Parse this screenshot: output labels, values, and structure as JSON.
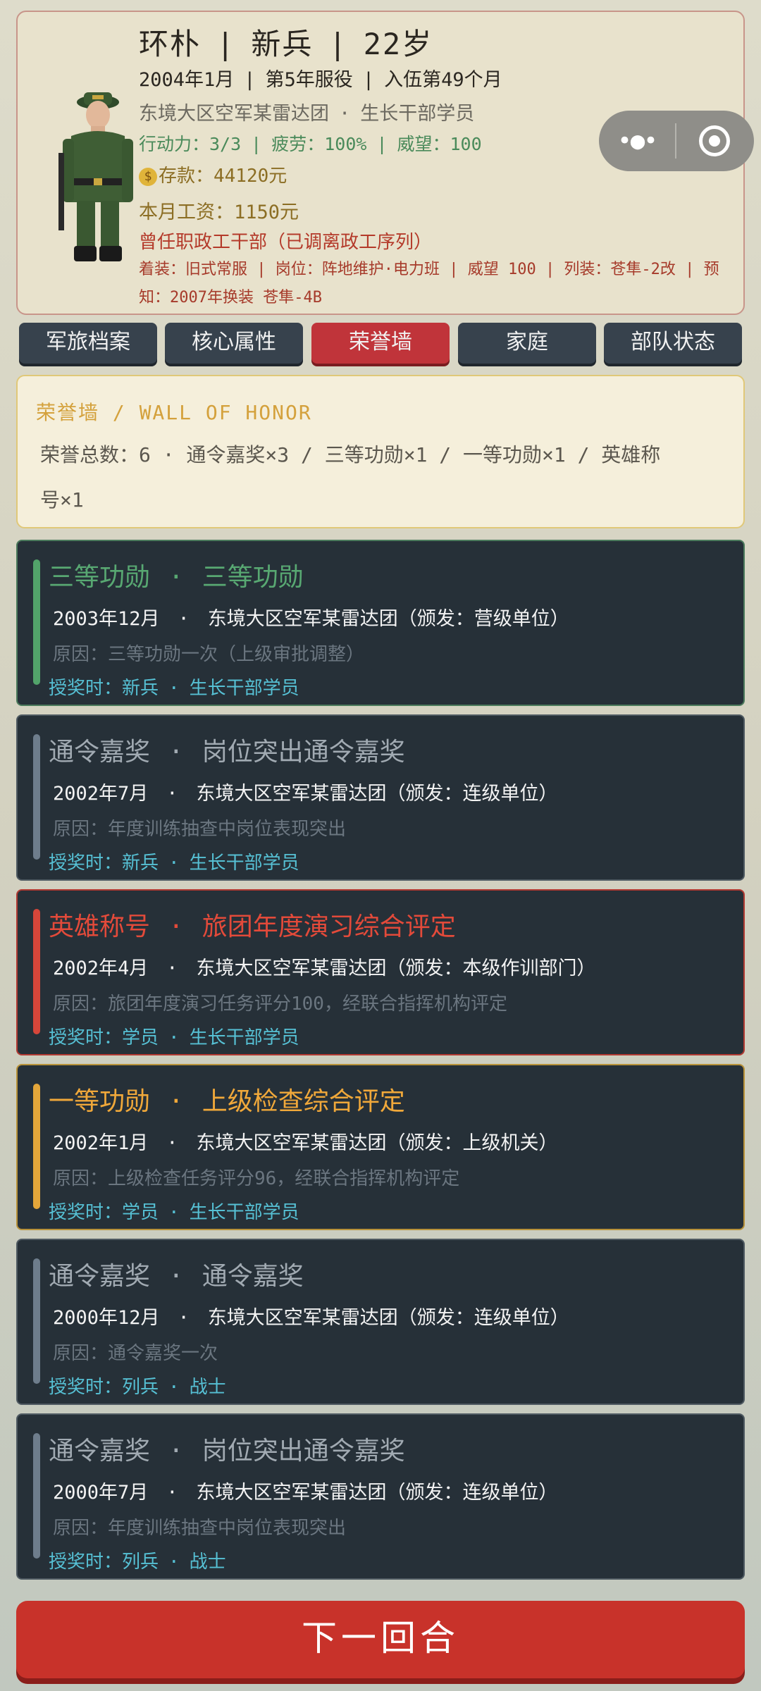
{
  "profile": {
    "name": "环朴",
    "rank": "新兵",
    "age": "22岁",
    "date": "2004年1月",
    "service_year": "第5年服役",
    "enlist": "入伍第49个月",
    "unit": "东境大区空军某雷达团",
    "role": "生长干部学员",
    "action": "行动力：3/3",
    "fatigue": "疲劳：100%",
    "prestige": "威望：100",
    "savings": "存款：44120元",
    "salary": "本月工资：1150元",
    "former": "曾任职政工干部（已调离政工序列）",
    "equipment": "着装：旧式常服 | 岗位：阵地维护·电力班 | 威望 100 | 列装：苍隼-2改 | 预知：2007年换装 苍隼-4B",
    "avatar_icon": "soldier-avatar-icon",
    "coin_icon": "money-bag-icon"
  },
  "capsule": {
    "more_icon": "more-dots-icon",
    "close_icon": "target-circle-icon"
  },
  "tabs": [
    {
      "label": "军旅档案",
      "active": false
    },
    {
      "label": "核心属性",
      "active": false
    },
    {
      "label": "荣誉墙",
      "active": true
    },
    {
      "label": "家庭",
      "active": false
    },
    {
      "label": "部队状态",
      "active": false
    }
  ],
  "summary": {
    "title": "荣誉墙 / WALL OF HONOR",
    "text_line1": "荣誉总数：6 · 通令嘉奖×3 / 三等功勋×1 / 一等功勋×1 / 英雄称",
    "text_line2": "号×1"
  },
  "awards": [
    {
      "type": "三等功勋",
      "name": "三等功勋",
      "date": "2003年12月",
      "unit": "东境大区空军某雷达团（颁发：营级单位）",
      "reason": "原因：三等功勋一次（上级审批调整）",
      "rank": "授奖时：新兵",
      "role": "生长干部学员",
      "accent": "#52a36a"
    },
    {
      "type": "通令嘉奖",
      "name": "岗位突出通令嘉奖",
      "date": "2002年7月",
      "unit": "东境大区空军某雷达团（颁发：连级单位）",
      "reason": "原因：年度训练抽查中岗位表现突出",
      "rank": "授奖时：新兵",
      "role": "生长干部学员",
      "accent": "#6e7d8c"
    },
    {
      "type": "英雄称号",
      "name": "旅团年度演习综合评定",
      "date": "2002年4月",
      "unit": "东境大区空军某雷达团（颁发：本级作训部门）",
      "reason": "原因：旅团年度演习任务评分100，经联合指挥机构评定",
      "rank": "授奖时：学员",
      "role": "生长干部学员",
      "accent": "#d6463a"
    },
    {
      "type": "一等功勋",
      "name": "上级检查综合评定",
      "date": "2002年1月",
      "unit": "东境大区空军某雷达团（颁发：上级机关）",
      "reason": "原因：上级检查任务评分96，经联合指挥机构评定",
      "rank": "授奖时：学员",
      "role": "生长干部学员",
      "accent": "#e3a63a"
    },
    {
      "type": "通令嘉奖",
      "name": "通令嘉奖",
      "date": "2000年12月",
      "unit": "东境大区空军某雷达团（颁发：连级单位）",
      "reason": "原因：通令嘉奖一次",
      "rank": "授奖时：列兵",
      "role": "战士",
      "accent": "#6e7d8c"
    },
    {
      "type": "通令嘉奖",
      "name": "岗位突出通令嘉奖",
      "date": "2000年7月",
      "unit": "东境大区空军某雷达团（颁发：连级单位）",
      "reason": "原因：年度训练抽查中岗位表现突出",
      "rank": "授奖时：列兵",
      "role": "战士",
      "accent": "#6e7d8c"
    }
  ],
  "next_button": "下一回合"
}
